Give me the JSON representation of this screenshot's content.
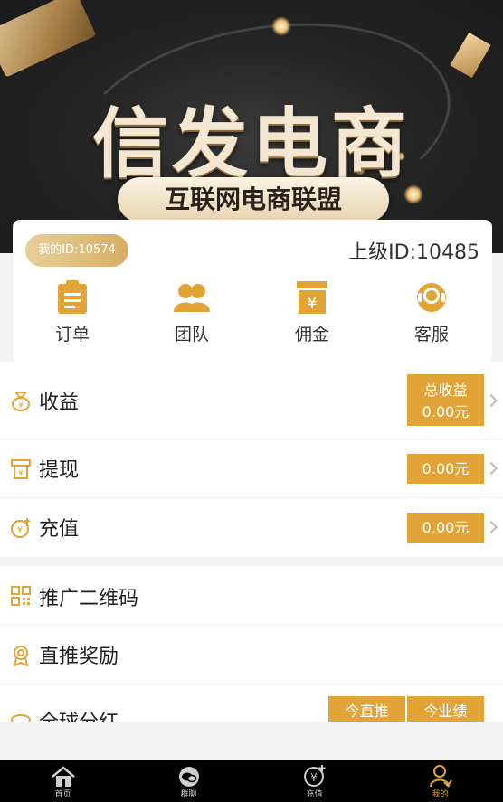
{
  "banner": {
    "title": "信发电商",
    "subtitle": "互联网电商联盟"
  },
  "card": {
    "my_id": "我的ID:10574",
    "parent_id": "上级ID:10485",
    "quick": [
      {
        "label": "订单",
        "icon": "order-clipboard-icon"
      },
      {
        "label": "团队",
        "icon": "team-people-icon"
      },
      {
        "label": "佣金",
        "icon": "commission-yen-icon"
      },
      {
        "label": "客服",
        "icon": "customer-service-headset-icon"
      }
    ]
  },
  "finance": {
    "income": {
      "label": "收益",
      "btn_line1": "总收益",
      "btn_line2": "0.00元"
    },
    "withdraw": {
      "label": "提现",
      "btn": "0.00元"
    },
    "recharge": {
      "label": "充值",
      "btn": "0.00元"
    }
  },
  "menu": {
    "qrcode": "推广二维码",
    "direct_reward": "直推奖励",
    "global_dividend": "全球分红",
    "today_direct": "今直推",
    "today_performance": "今业绩"
  },
  "tabbar": [
    {
      "label": "首页",
      "icon": "home-icon"
    },
    {
      "label": "群聊",
      "icon": "chat-bubble-icon"
    },
    {
      "label": "充值",
      "icon": "recharge-yen-icon"
    },
    {
      "label": "我的",
      "icon": "profile-icon"
    }
  ],
  "colors": {
    "accent": "#e2a437",
    "gold_light": "#e9cf98",
    "banner_bg": "#252525"
  }
}
